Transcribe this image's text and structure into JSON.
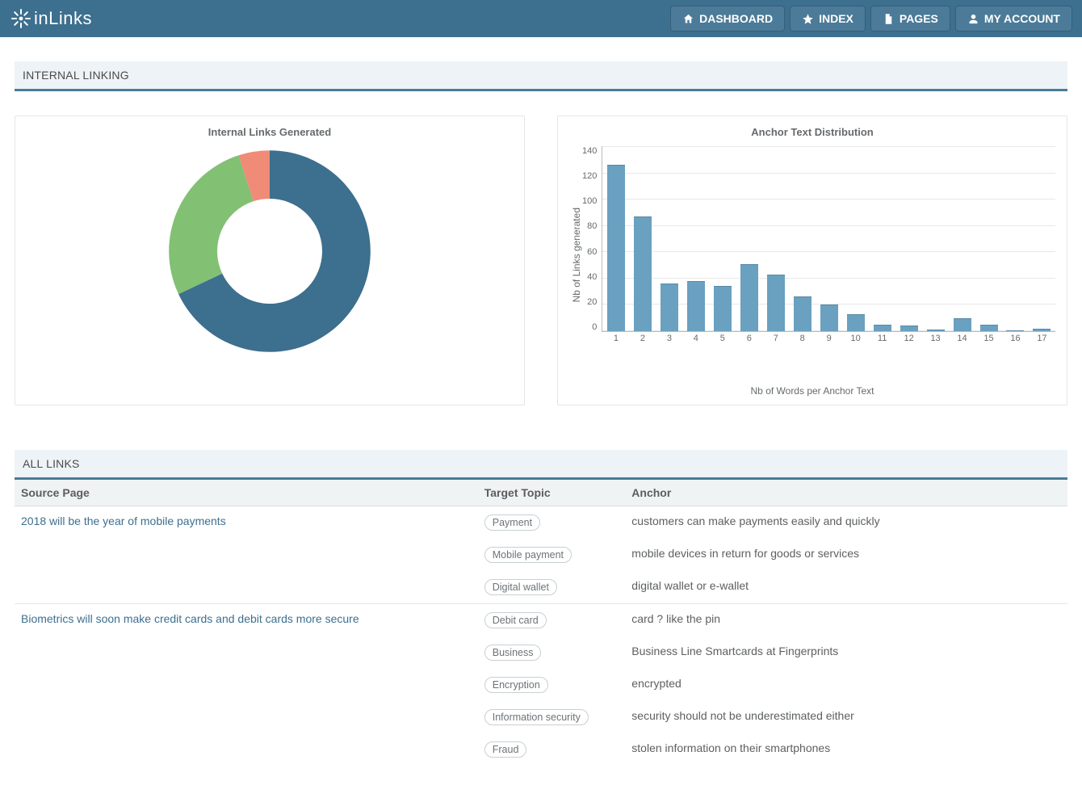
{
  "brand": {
    "name": "inLinks"
  },
  "nav": {
    "dashboard": "DASHBOARD",
    "index": "INDEX",
    "pages": "PAGES",
    "account": "MY ACCOUNT"
  },
  "sections": {
    "internal_linking": "INTERNAL LINKING",
    "all_links": "ALL LINKS"
  },
  "table": {
    "headers": {
      "source": "Source Page",
      "topic": "Target Topic",
      "anchor": "Anchor"
    },
    "rows": [
      {
        "source": "2018 will be the year of mobile payments",
        "items": [
          {
            "topic": "Payment",
            "anchor": "customers can make payments easily and quickly"
          },
          {
            "topic": "Mobile payment",
            "anchor": "mobile devices in return for goods or services"
          },
          {
            "topic": "Digital wallet",
            "anchor": "digital wallet or e-wallet"
          }
        ]
      },
      {
        "source": "Biometrics will soon make credit cards and debit cards more secure",
        "items": [
          {
            "topic": "Debit card",
            "anchor": "card ? like the pin"
          },
          {
            "topic": "Business",
            "anchor": "Business Line Smartcards at Fingerprints"
          },
          {
            "topic": "Encryption",
            "anchor": "encrypted"
          },
          {
            "topic": "Information security",
            "anchor": "security should not be underestimated either"
          },
          {
            "topic": "Fraud",
            "anchor": "stolen information on their smartphones"
          }
        ]
      }
    ]
  },
  "chart_data": [
    {
      "type": "pie",
      "title": "Internal Links Generated",
      "series": [
        {
          "name": "slice-blue",
          "value": 68,
          "color": "#3d6f8e"
        },
        {
          "name": "slice-green",
          "value": 27,
          "color": "#82c074"
        },
        {
          "name": "slice-salmon",
          "value": 5,
          "color": "#ef8b77"
        }
      ]
    },
    {
      "type": "bar",
      "title": "Anchor Text Distribution",
      "xlabel": "Nb of Words per Anchor Text",
      "ylabel": "Nb of Links generated",
      "ylim": [
        0,
        140
      ],
      "yticks": [
        0,
        20,
        40,
        60,
        80,
        100,
        120,
        140
      ],
      "categories": [
        "1",
        "2",
        "3",
        "4",
        "5",
        "6",
        "7",
        "8",
        "9",
        "10",
        "11",
        "12",
        "13",
        "14",
        "15",
        "16",
        "17"
      ],
      "values": [
        126,
        87,
        36,
        38,
        34,
        51,
        43,
        26,
        20,
        13,
        5,
        4,
        1,
        10,
        5,
        0,
        2
      ]
    }
  ]
}
